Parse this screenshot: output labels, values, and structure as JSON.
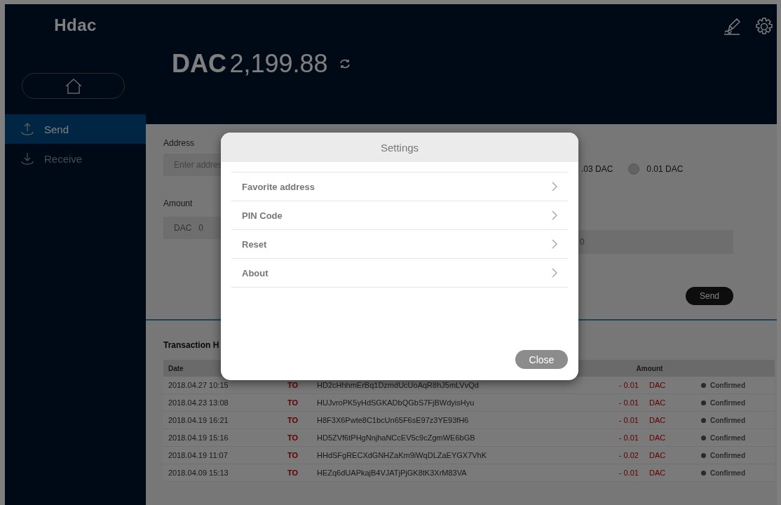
{
  "logo": "Hdac",
  "balance": {
    "currency": "DAC",
    "amount": "2,199.88"
  },
  "sidebar": {
    "items": [
      {
        "label": "Send",
        "kind": "send",
        "selected": true
      },
      {
        "label": "Receive",
        "kind": "receive",
        "selected": false
      }
    ]
  },
  "send_form": {
    "address_label": "Address",
    "address_placeholder": "Enter addres",
    "fee_options": [
      {
        "label": ".03 DAC"
      },
      {
        "label": "0.01 DAC",
        "selected": false
      }
    ],
    "amount_label": "Amount",
    "amount_currency": "DAC",
    "amount_value": "0",
    "converted_value": "0",
    "send_button": "Send"
  },
  "transaction_history": {
    "title": "Transaction H",
    "columns": [
      "Date",
      "Amount"
    ],
    "rows": [
      {
        "date": "2018.04.27 10:15",
        "type": "TO",
        "address": "HD2cHhhmErBq1DzmdUcUoAqR8hJ5mLVvQd",
        "amount": "- 0.01",
        "unit": "DAC",
        "status": "Confirmed"
      },
      {
        "date": "2018.04.23 13:08",
        "type": "TO",
        "address": "HUJvroPK5yHdSGKADbQGbS7FjBWdyisHyu",
        "amount": "- 0.01",
        "unit": "DAC",
        "status": "Confirmed"
      },
      {
        "date": "2018.04.19 16:21",
        "type": "TO",
        "address": "H8F3X6Pwte8C1bcUn65F6sE97z3YE93fH6",
        "amount": "- 0.01",
        "unit": "DAC",
        "status": "Confirmed"
      },
      {
        "date": "2018.04.19 15:16",
        "type": "TO",
        "address": "HD5ZVf6tPHgNnjhaNCcEV5c9cZgmWE6bGB",
        "amount": "- 0.01",
        "unit": "DAC",
        "status": "Confirmed"
      },
      {
        "date": "2018.04.19 11:07",
        "type": "TO",
        "address": "HHdSFgRECXdGNHZaKm9iWqDLZaEYGX7VhK",
        "amount": "- 0.02",
        "unit": "DAC",
        "status": "Confirmed"
      },
      {
        "date": "2018.04.09 15:13",
        "type": "TO",
        "address": "HEZq6dUAPkajB4VJATjPjGK8tK3XrM83VA",
        "amount": "- 0.01",
        "unit": "DAC",
        "status": "Confirmed"
      }
    ]
  },
  "settings_dialog": {
    "title": "Settings",
    "items": [
      {
        "label": "Favorite address"
      },
      {
        "label": "PIN Code"
      },
      {
        "label": "Reset"
      },
      {
        "label": "About"
      }
    ],
    "close_button": "Close"
  }
}
